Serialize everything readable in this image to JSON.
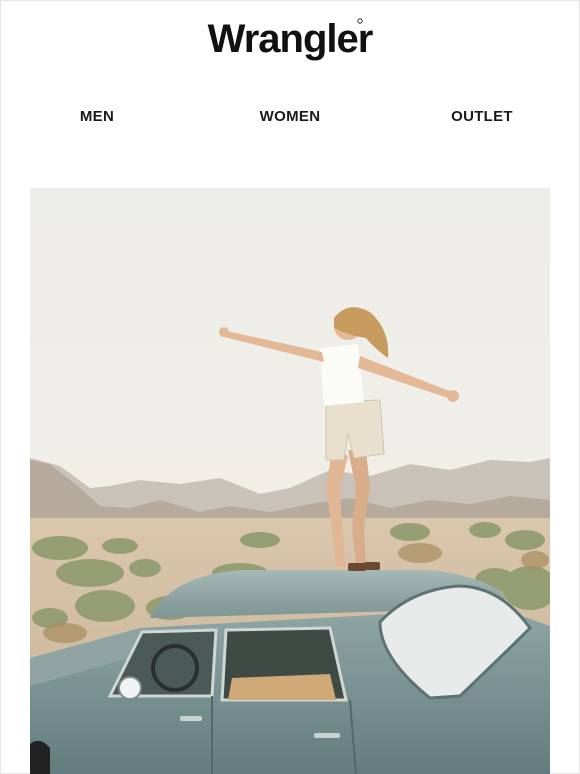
{
  "header": {
    "brand": "Wrangler"
  },
  "nav": {
    "items": [
      {
        "label": "MEN"
      },
      {
        "label": "WOMEN"
      },
      {
        "label": "OUTLET"
      }
    ]
  },
  "hero": {
    "image_icon": "hero-photo-woman-on-car-desert"
  },
  "colors": {
    "text": "#1a1a1a",
    "sky": "#efece4",
    "car": "#7b9697"
  }
}
